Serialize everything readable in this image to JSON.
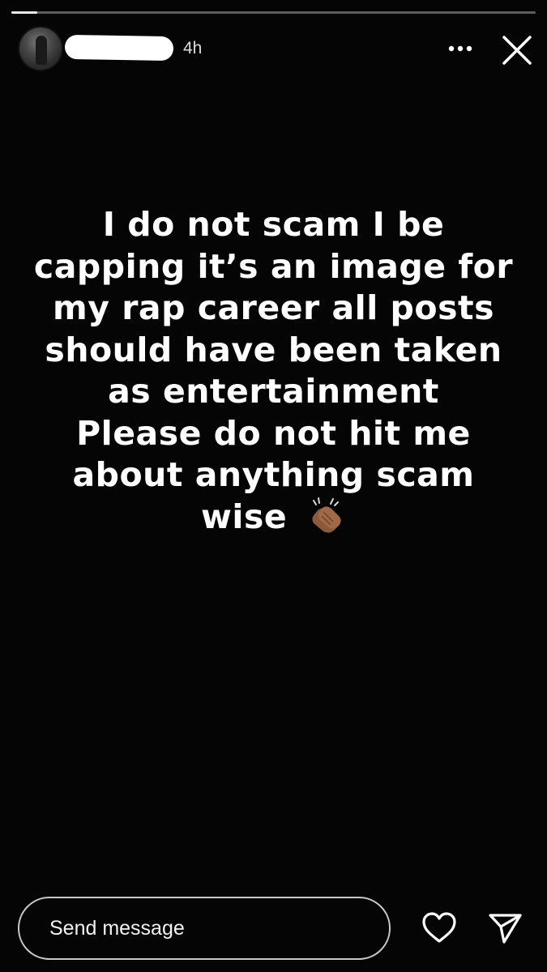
{
  "story": {
    "progress_fraction": 0.05,
    "time_ago": "4h",
    "text_lines": [
      "I do not scam I be",
      "capping it’s an image for",
      "my rap career all posts",
      "should have been taken",
      "as entertainment",
      "Please do not hit me",
      "about anything scam",
      "wise"
    ],
    "emoji": "clapping-hands"
  },
  "header": {
    "more_icon": "more-horizontal-icon",
    "close_icon": "close-icon"
  },
  "footer": {
    "message_placeholder": "Send message",
    "like_icon": "heart-icon",
    "share_icon": "send-icon"
  },
  "colors": {
    "background": "#050505",
    "text": "#ffffff",
    "field_border": "#c9c9c9"
  }
}
